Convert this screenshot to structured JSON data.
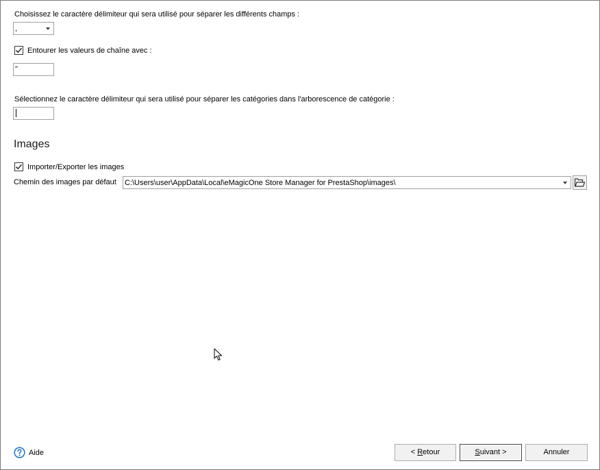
{
  "delimiter": {
    "label": "Choisissez le caractère délimiteur qui sera utilisé pour séparer les différents champs :",
    "value": ","
  },
  "quote": {
    "checkbox_label": "Entourer les valeurs de chaîne avec :",
    "checked": true,
    "value": "\""
  },
  "category": {
    "label": "Sélectionnez le caractère délimiteur qui sera utilisé pour séparer les catégories dans l'arborescence de catégorie :",
    "value": ""
  },
  "images": {
    "section_title": "Images",
    "checkbox_label": "Importer/Exporter les images",
    "checked": true,
    "path_label": "Chemin des images par défaut",
    "path_value": "C:\\Users\\user\\AppData\\Local\\eMagicOne Store Manager for PrestaShop\\images\\"
  },
  "footer": {
    "help_label": "Aide",
    "back_mnemonic": "R",
    "back_rest": "etour",
    "next_mnemonic": "S",
    "next_rest": "uivant >",
    "cancel_label": "Annuler"
  },
  "colors": {
    "help_icon": "#1e6fc6",
    "folder_icon": "#333333"
  }
}
